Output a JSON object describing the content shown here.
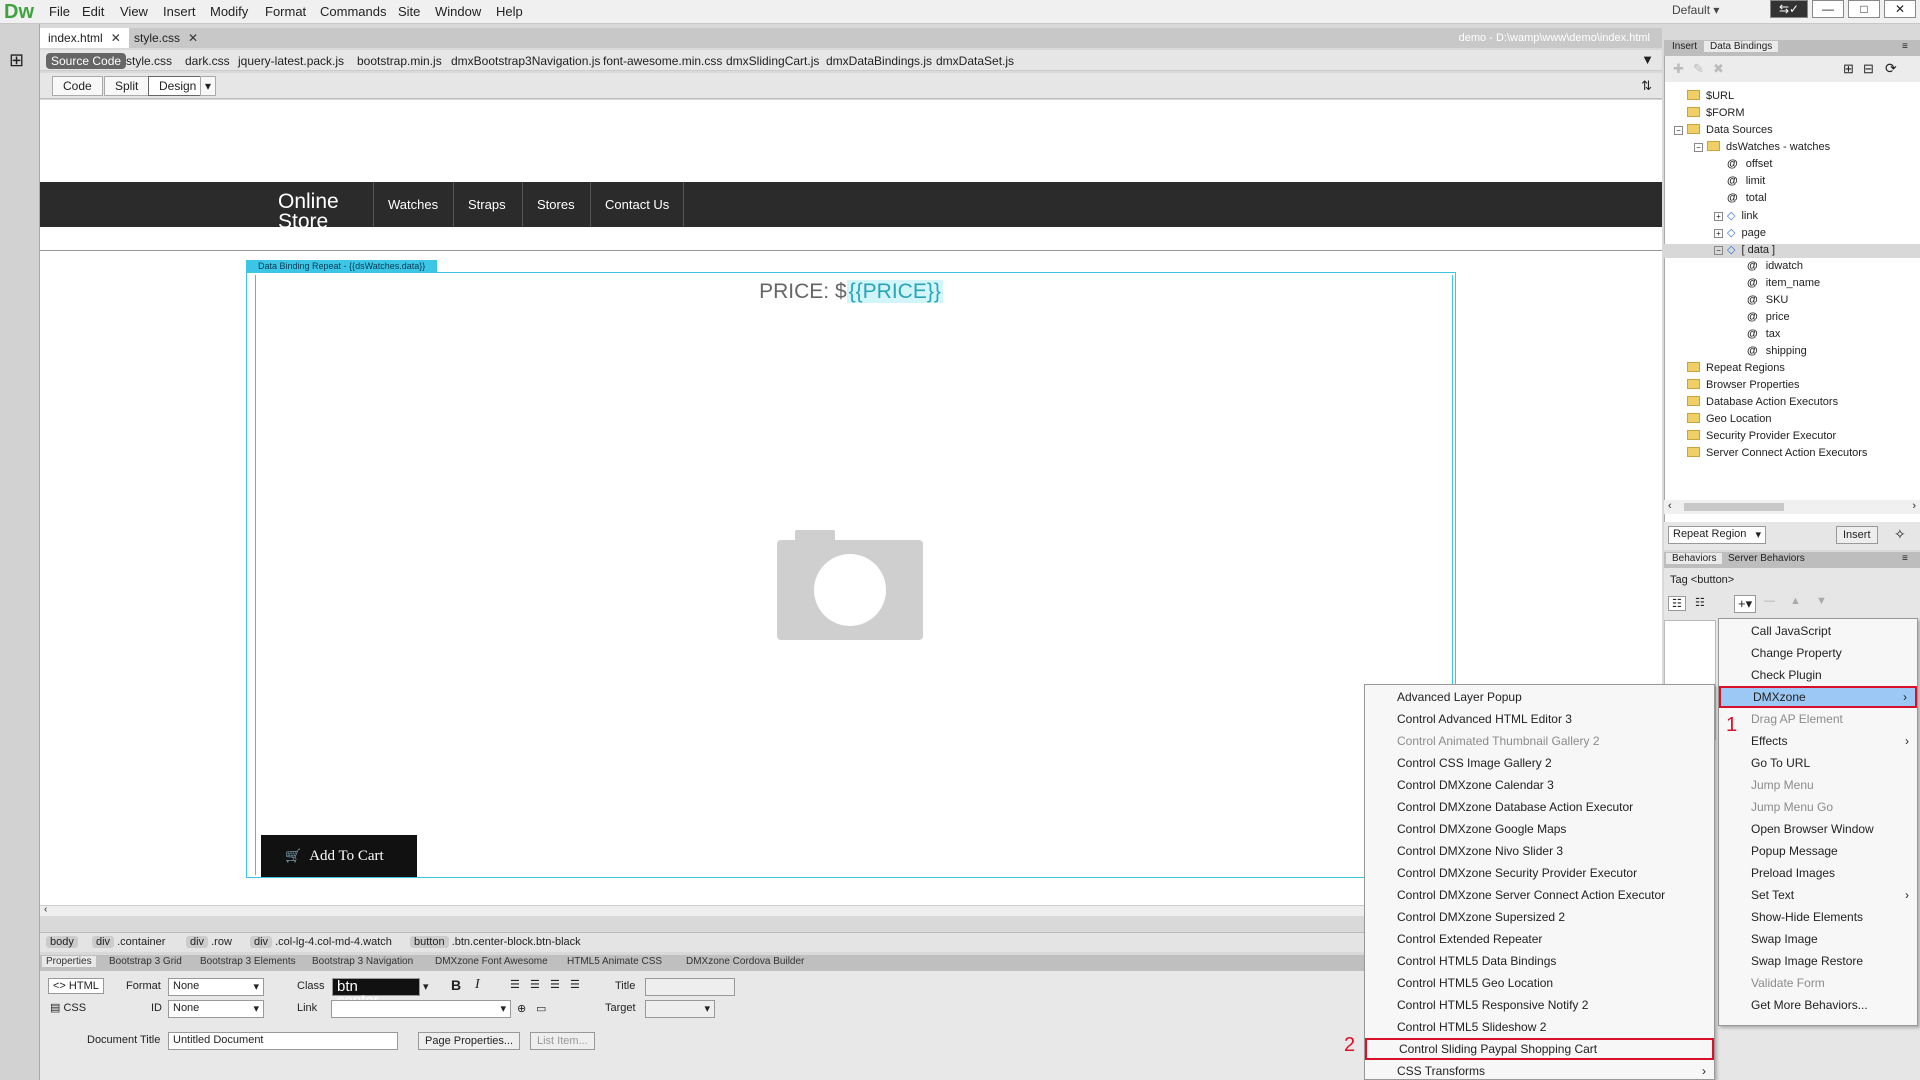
{
  "app": {
    "logo": "Dw",
    "workspace": "Default"
  },
  "menubar": [
    "File",
    "Edit",
    "View",
    "Insert",
    "Modify",
    "Format",
    "Commands",
    "Site",
    "Window",
    "Help"
  ],
  "doc_tabs": [
    {
      "label": "index.html",
      "active": true
    },
    {
      "label": "style.css",
      "active": false
    }
  ],
  "doc_path": "demo - D:\\wamp\\www\\demo\\index.html",
  "related_files": [
    "Source Code",
    "style.css",
    "dark.css",
    "jquery-latest.pack.js",
    "bootstrap.min.js",
    "dmxBootstrap3Navigation.js",
    "font-awesome.min.css",
    "dmxSlidingCart.js",
    "dmxDataBindings.js",
    "dmxDataSet.js"
  ],
  "modes": [
    "Code",
    "Split",
    "Design"
  ],
  "page": {
    "brand": "Online Store",
    "nav_links": [
      "Watches",
      "Straps",
      "Stores",
      "Contact Us"
    ],
    "repeat_label": "Data Binding Repeat - {{dsWatches.data}}",
    "price_prefix": "PRICE: $",
    "price_expr": "{{PRICE}}",
    "add_to_cart": "Add To Cart"
  },
  "tag_selector": [
    {
      "tag": "body",
      "detail": ""
    },
    {
      "tag": "div",
      "detail": ".container"
    },
    {
      "tag": "div",
      "detail": ".row"
    },
    {
      "tag": "div",
      "detail": ".col-lg-4.col-md-4.watch"
    },
    {
      "tag": "button",
      "detail": ".btn.center-block.btn-black"
    }
  ],
  "props_tabs": [
    "Properties",
    "Bootstrap 3 Grid",
    "Bootstrap 3 Elements",
    "Bootstrap 3 Navigation",
    "DMXzone Font Awesome",
    "HTML5 Animate CSS",
    "DMXzone Cordova Builder"
  ],
  "props": {
    "html_label": "HTML",
    "css_label": "CSS",
    "format_label": "Format",
    "format_value": "None",
    "id_label": "ID",
    "id_value": "None",
    "class_label": "Class",
    "class_value": "btn center...",
    "link_label": "Link",
    "title_label": "Title",
    "target_label": "Target",
    "doc_title_label": "Document Title",
    "doc_title_value": "Untitled Document",
    "page_props": "Page Properties...",
    "list_item": "List Item..."
  },
  "right_tabs": [
    "Insert",
    "Data Bindings"
  ],
  "bindings_tree": [
    {
      "label": "$URL",
      "type": "folder",
      "level": 0
    },
    {
      "label": "$FORM",
      "type": "folder",
      "level": 0
    },
    {
      "label": "Data Sources",
      "type": "folder",
      "level": 0,
      "pm": "−"
    },
    {
      "label": "dsWatches - watches",
      "type": "folder",
      "level": 1,
      "pm": "−"
    },
    {
      "label": "offset",
      "type": "at",
      "level": 2
    },
    {
      "label": "limit",
      "type": "at",
      "level": 2
    },
    {
      "label": "total",
      "type": "at",
      "level": 2
    },
    {
      "label": "link",
      "type": "diamond",
      "level": 2,
      "pm": "+"
    },
    {
      "label": "page",
      "type": "diamond",
      "level": 2,
      "pm": "+"
    },
    {
      "label": "[ data ]",
      "type": "diamond",
      "level": 2,
      "pm": "−",
      "selected": true
    },
    {
      "label": "idwatch",
      "type": "at",
      "level": 3
    },
    {
      "label": "item_name",
      "type": "at",
      "level": 3
    },
    {
      "label": "SKU",
      "type": "at",
      "level": 3
    },
    {
      "label": "price",
      "type": "at",
      "level": 3
    },
    {
      "label": "tax",
      "type": "at",
      "level": 3
    },
    {
      "label": "shipping",
      "type": "at",
      "level": 3
    },
    {
      "label": "Repeat Regions",
      "type": "folder",
      "level": 0
    },
    {
      "label": "Browser Properties",
      "type": "folder",
      "level": 0
    },
    {
      "label": "Database Action Executors",
      "type": "folder",
      "level": 0
    },
    {
      "label": "Geo Location",
      "type": "folder",
      "level": 0
    },
    {
      "label": "Security Provider Executor",
      "type": "folder",
      "level": 0
    },
    {
      "label": "Server Connect Action Executors",
      "type": "folder",
      "level": 0
    }
  ],
  "bindings_footer": {
    "select": "Repeat Region",
    "insert": "Insert"
  },
  "behaviors_tabs": [
    "Behaviors",
    "Server Behaviors"
  ],
  "behaviors_tag": "Tag <button>",
  "behaviors_menu": [
    {
      "label": "Call JavaScript"
    },
    {
      "label": "Change Property"
    },
    {
      "label": "Check Plugin"
    },
    {
      "label": "DMXzone",
      "submenu": true,
      "highlight": true
    },
    {
      "label": "Drag AP Element",
      "disabled": true
    },
    {
      "label": "Effects",
      "submenu": true
    },
    {
      "label": "Go To URL"
    },
    {
      "label": "Jump Menu",
      "disabled": true
    },
    {
      "label": "Jump Menu Go",
      "disabled": true
    },
    {
      "label": "Open Browser Window"
    },
    {
      "label": "Popup Message"
    },
    {
      "label": "Preload Images"
    },
    {
      "label": "Set Text",
      "submenu": true
    },
    {
      "label": "Show-Hide Elements"
    },
    {
      "label": "Swap Image"
    },
    {
      "label": "Swap Image Restore"
    },
    {
      "label": "Validate Form",
      "disabled": true
    },
    {
      "label": "Get More Behaviors..."
    }
  ],
  "dmxzone_menu": [
    {
      "label": "Advanced Layer Popup"
    },
    {
      "label": "Control Advanced HTML Editor 3"
    },
    {
      "label": "Control Animated Thumbnail Gallery 2",
      "disabled": true
    },
    {
      "label": "Control CSS Image Gallery 2"
    },
    {
      "label": "Control DMXzone Calendar 3"
    },
    {
      "label": "Control DMXzone Database Action Executor"
    },
    {
      "label": "Control DMXzone Google Maps"
    },
    {
      "label": "Control DMXzone Nivo Slider 3"
    },
    {
      "label": "Control DMXzone Security Provider Executor"
    },
    {
      "label": "Control DMXzone Server Connect Action Executor"
    },
    {
      "label": "Control DMXzone Supersized 2"
    },
    {
      "label": "Control Extended Repeater"
    },
    {
      "label": "Control HTML5 Data Bindings"
    },
    {
      "label": "Control HTML5 Geo Location"
    },
    {
      "label": "Control HTML5 Responsive Notify 2"
    },
    {
      "label": "Control HTML5 Slideshow 2"
    },
    {
      "label": "Control Sliding Paypal Shopping Cart",
      "boxed": true
    },
    {
      "label": "CSS Transforms",
      "submenu": true
    }
  ],
  "markers": [
    "1",
    "2"
  ],
  "colors": {
    "selection_box": "#d8102a",
    "binding_box": "#3cc6e6",
    "nav_bg": "#2b2b2b"
  }
}
